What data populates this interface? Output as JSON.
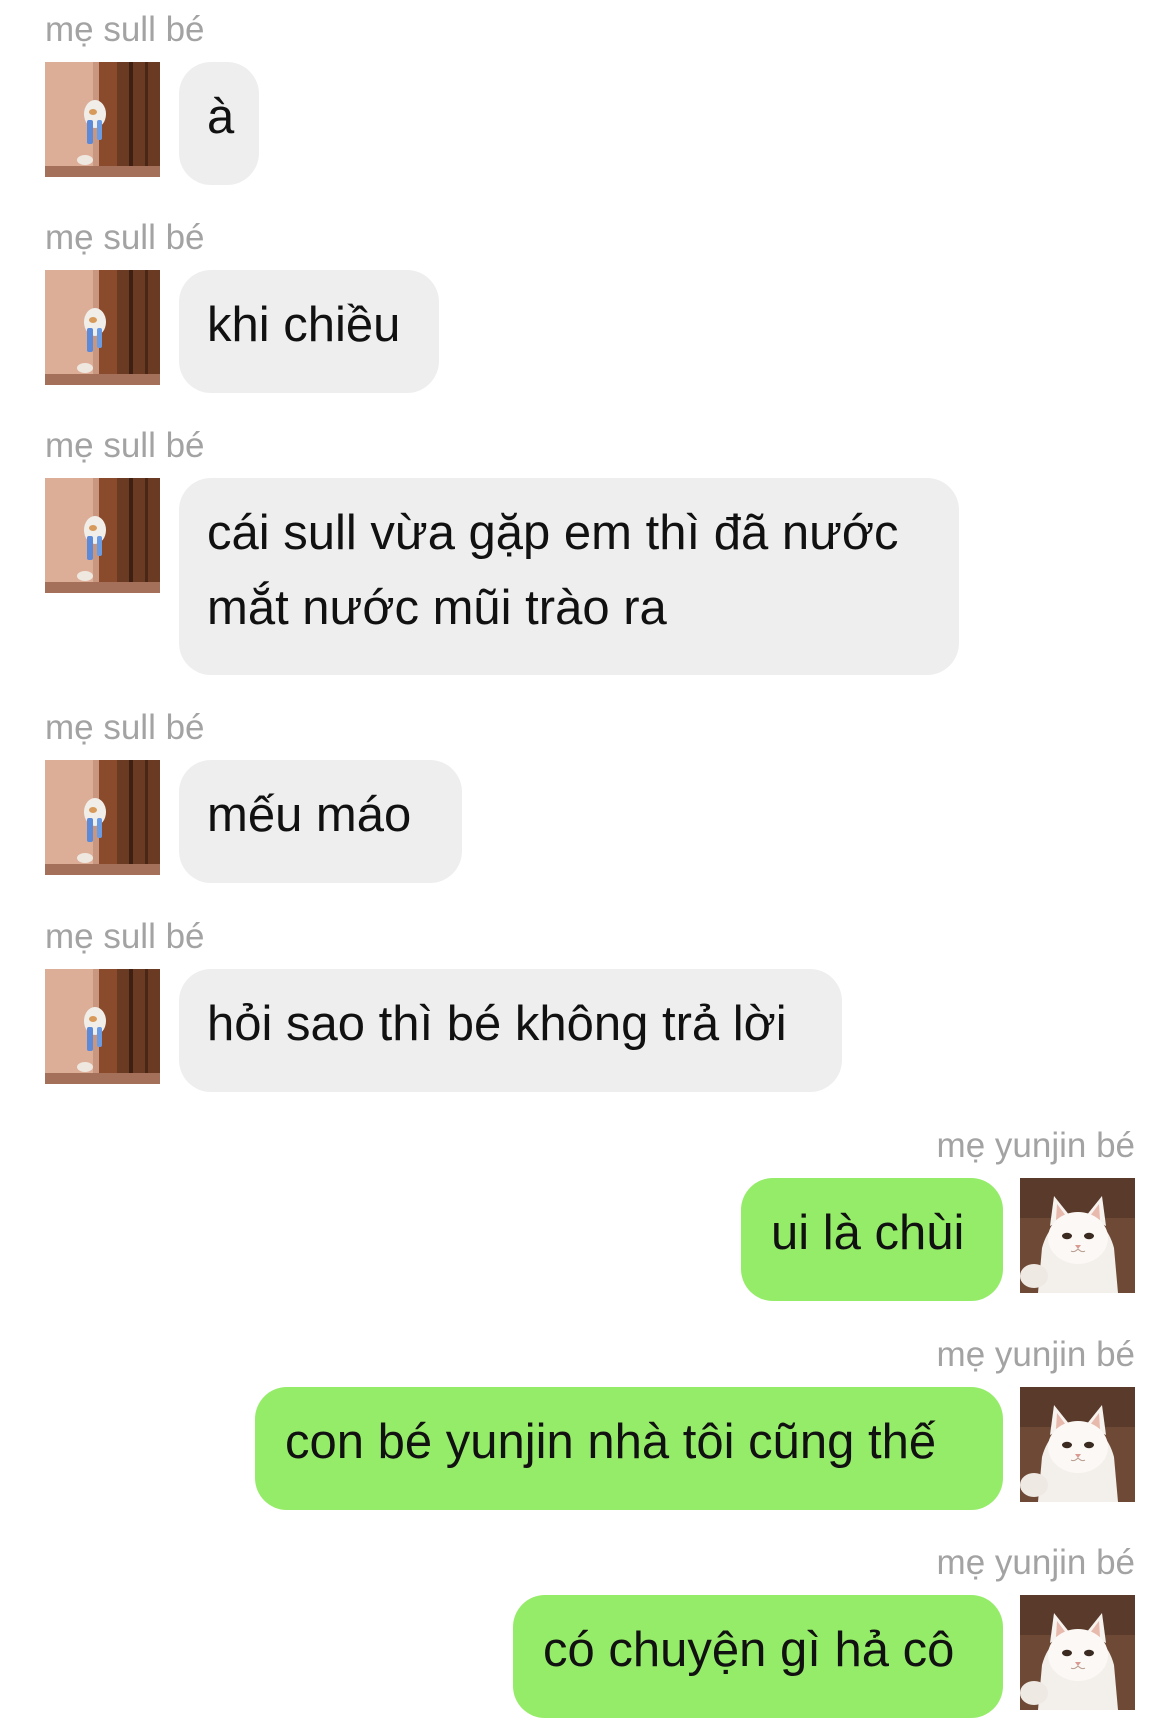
{
  "colors": {
    "background": "#ffffff",
    "incoming_bubble": "#eeeeee",
    "outgoing_bubble": "#95ec69",
    "sender_name": "#a3a3a3",
    "message_text": "#111111"
  },
  "messages": [
    {
      "sender": "mẹ sull bé",
      "text": "à",
      "direction": "incoming",
      "avatar": "peeking-cat-avatar-icon"
    },
    {
      "sender": "mẹ sull bé",
      "text": "khi chiều",
      "direction": "incoming",
      "avatar": "peeking-cat-avatar-icon"
    },
    {
      "sender": "mẹ sull bé",
      "text": "cái sull vừa gặp em thì đã nước mắt nước mũi trào ra",
      "direction": "incoming",
      "avatar": "peeking-cat-avatar-icon"
    },
    {
      "sender": "mẹ sull bé",
      "text": "mếu máo",
      "direction": "incoming",
      "avatar": "peeking-cat-avatar-icon"
    },
    {
      "sender": "mẹ sull bé",
      "text": "hỏi sao thì bé không trả lời",
      "direction": "incoming",
      "avatar": "peeking-cat-avatar-icon"
    },
    {
      "sender": "mẹ yunjin bé",
      "text": "ui là chùi",
      "direction": "outgoing",
      "avatar": "white-cat-avatar-icon"
    },
    {
      "sender": "mẹ yunjin bé",
      "text": "con bé yunjin nhà tôi cũng thế",
      "direction": "outgoing",
      "avatar": "white-cat-avatar-icon"
    },
    {
      "sender": "mẹ yunjin bé",
      "text": "có chuyện gì hả cô",
      "direction": "outgoing",
      "avatar": "white-cat-avatar-icon"
    }
  ]
}
